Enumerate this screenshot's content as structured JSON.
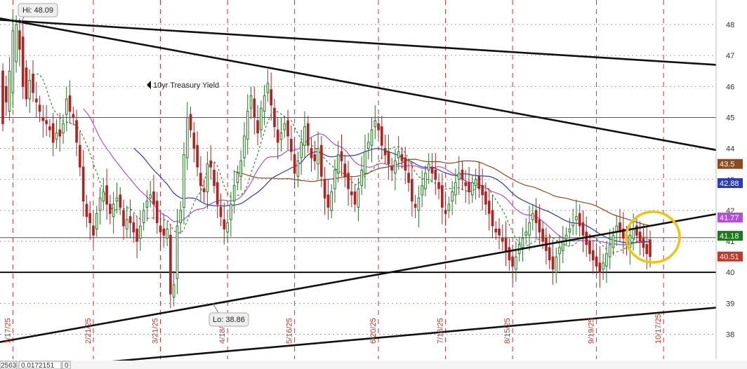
{
  "chart_data": {
    "type": "candlestick",
    "ylim": [
      37.6,
      48.7
    ],
    "y_ticks": [
      38,
      39,
      40,
      41,
      42,
      43,
      44,
      45,
      46,
      47,
      48
    ],
    "x_ticks": [
      {
        "label": "1/17/25",
        "i": 3
      },
      {
        "label": "2/21/25",
        "i": 27
      },
      {
        "label": "3/21/25",
        "i": 47
      },
      {
        "label": "4/18/25",
        "i": 67
      },
      {
        "label": "5/16/25",
        "i": 87
      },
      {
        "label": "6/20/25",
        "i": 112
      },
      {
        "label": "7/18/25",
        "i": 132
      },
      {
        "label": "8/15/25",
        "i": 152
      },
      {
        "label": "9/19/25",
        "i": 177
      },
      {
        "label": "10/17/25",
        "i": 197
      }
    ],
    "annotations": {
      "series_label": "10yr Treasury Yield",
      "high": "Hi: 48.09",
      "low": "Lo: 38.86"
    },
    "price_badges": [
      {
        "label": "43.5",
        "value": 43.5,
        "color": "#8a4b1e"
      },
      {
        "label": "42.88",
        "value": 42.88,
        "color": "#2a3bb8"
      },
      {
        "label": "41.77",
        "value": 41.77,
        "color": "#b14fd6"
      },
      {
        "label": "41.18",
        "value": 41.18,
        "color": "#1f7a1f"
      },
      {
        "label": "40.51",
        "value": 40.51,
        "color": "#c0392b"
      }
    ],
    "status_bar": [
      "2563",
      "0.0172151",
      "0"
    ],
    "closes": [
      44.8,
      45.5,
      46.5,
      47.8,
      48.0,
      47.2,
      46.0,
      45.6,
      46.2,
      45.8,
      45.5,
      45.2,
      44.9,
      44.8,
      44.6,
      44.2,
      44.5,
      44.4,
      44.8,
      45.6,
      45.2,
      45.0,
      44.2,
      43.4,
      42.3,
      41.8,
      41.6,
      41.2,
      41.9,
      42.4,
      42.6,
      42.2,
      41.9,
      42.2,
      42.4,
      42.1,
      41.5,
      41.7,
      41.6,
      41.3,
      41.0,
      41.5,
      42.0,
      42.3,
      42.5,
      42.2,
      41.6,
      41.3,
      41.2,
      41.4,
      39.3,
      39.6,
      41.5,
      42.0,
      43.8,
      45.0,
      44.6,
      44.0,
      43.4,
      42.8,
      42.6,
      43.5,
      43.4,
      42.8,
      42.2,
      41.8,
      41.4,
      41.6,
      42.2,
      42.8,
      43.2,
      43.6,
      44.4,
      45.2,
      45.7,
      45.0,
      44.5,
      45.3,
      45.7,
      46.1,
      45.4,
      44.7,
      44.2,
      44.5,
      44.8,
      44.4,
      43.9,
      43.2,
      43.6,
      44.2,
      44.7,
      44.1,
      43.7,
      43.6,
      44.0,
      43.1,
      42.4,
      42.1,
      42.6,
      43.3,
      43.8,
      43.6,
      43.1,
      42.7,
      42.5,
      42.2,
      42.7,
      43.3,
      43.9,
      44.2,
      44.6,
      44.9,
      44.6,
      44.1,
      43.8,
      43.5,
      43.3,
      43.6,
      43.9,
      43.6,
      43.3,
      42.9,
      42.3,
      42.1,
      42.4,
      42.8,
      43.2,
      43.5,
      43.2,
      43.0,
      42.7,
      42.1,
      41.9,
      42.2,
      42.6,
      42.9,
      43.2,
      43.0,
      42.8,
      42.6,
      42.9,
      43.0,
      42.7,
      42.5,
      42.2,
      41.9,
      41.5,
      41.3,
      41.2,
      41.0,
      40.7,
      40.4,
      40.2,
      40.5,
      40.9,
      41.1,
      41.3,
      41.6,
      41.9,
      41.6,
      41.3,
      41.0,
      40.7,
      40.4,
      40.1,
      40.5,
      40.8,
      41.0,
      41.2,
      41.4,
      41.6,
      41.8,
      41.5,
      41.2,
      40.9,
      40.6,
      40.4,
      40.2,
      40.0,
      40.3,
      40.6,
      40.9,
      41.2,
      41.5,
      41.3,
      41.1,
      40.9,
      41.2,
      41.4,
      41.2,
      41.0,
      40.8,
      40.6,
      40.51
    ],
    "hist_opens": [
      46.5,
      46.0,
      45.2,
      45.8,
      46.8,
      47.8,
      47.6,
      46.6,
      45.6,
      46.4,
      45.6,
      45.4,
      45.0,
      44.9,
      44.7,
      44.8,
      44.3,
      44.6,
      44.5,
      45.1,
      45.7,
      45.1,
      44.9,
      44.1,
      43.4,
      42.2,
      41.9,
      41.5,
      41.4,
      42.0,
      42.3,
      42.8,
      42.2,
      41.8,
      42.3,
      42.5,
      42.0,
      41.4,
      41.8,
      41.6,
      41.4,
      41.1,
      41.6,
      42.1,
      42.4,
      42.6,
      42.3,
      41.5,
      41.4,
      41.1,
      41.2,
      39.2,
      39.8,
      41.6,
      42.1,
      43.7,
      45.1,
      44.5,
      44.1,
      43.2,
      42.7,
      42.6,
      43.6,
      43.3,
      42.9,
      42.1,
      41.7,
      41.3,
      41.7,
      42.3,
      42.9,
      43.1,
      43.7,
      44.3,
      45.3,
      45.6,
      44.9,
      44.6,
      45.2,
      45.8,
      45.9,
      45.3,
      44.6,
      44.3,
      44.6,
      44.9,
      44.3,
      43.8,
      43.1,
      43.7,
      44.1,
      44.8,
      44.0,
      43.8,
      43.5,
      44.1,
      43.0,
      42.5,
      42.0,
      42.7,
      43.2,
      43.9,
      43.5,
      43.2,
      42.6,
      42.6,
      42.1,
      42.8,
      43.2,
      44.0,
      44.1,
      44.7,
      44.8,
      44.7,
      44.0,
      43.9,
      43.4,
      43.2,
      43.7,
      43.8,
      43.7,
      43.2,
      43.0,
      42.2,
      42.0,
      42.5,
      42.7,
      43.3,
      43.4,
      43.3,
      42.9,
      42.8,
      42.0,
      42.0,
      42.3,
      42.5,
      43.0,
      43.3,
      42.9,
      42.9,
      42.5,
      42.8,
      43.1,
      42.8,
      42.6,
      42.3,
      42.0,
      41.4,
      41.4,
      41.1,
      41.1,
      40.8,
      40.5,
      40.1,
      40.6,
      40.8,
      41.2,
      41.2,
      41.7,
      42.0,
      41.7,
      41.4,
      41.1,
      40.8,
      40.5,
      40.0,
      40.6,
      40.7,
      41.1,
      41.3,
      41.5,
      41.7,
      41.9,
      41.6,
      41.3,
      41.0,
      40.7,
      40.5,
      40.3,
      40.1,
      40.2,
      40.5,
      40.8,
      41.3,
      41.6,
      41.4,
      41.2,
      40.8,
      41.1,
      41.5,
      41.3,
      41.1,
      40.9,
      41.05
    ],
    "lines": [
      {
        "x1": 0,
        "y1": 48.15,
        "x2": 1020,
        "y2": 46.7
      },
      {
        "x1": 0,
        "y1": 48.2,
        "x2": 1020,
        "y2": 43.95
      },
      {
        "x1": 0,
        "y1": 37.75,
        "x2": 1020,
        "y2": 41.88
      },
      {
        "x1": 0,
        "y1": 36.8,
        "x2": 1020,
        "y2": 38.86
      }
    ],
    "hlines": [
      45.0,
      41.12,
      40.0
    ]
  }
}
